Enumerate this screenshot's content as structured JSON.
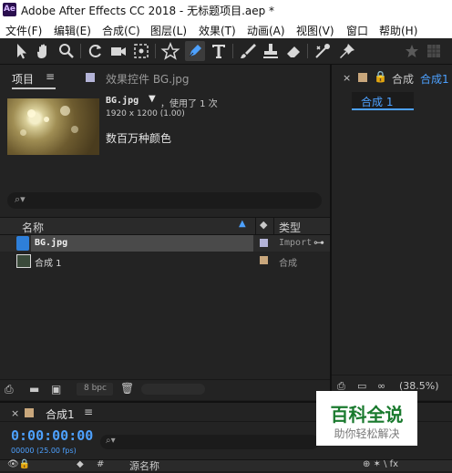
{
  "window": {
    "app_icon": "Ae",
    "title": "Adobe After Effects CC 2018 - 无标题项目.aep *"
  },
  "menu": [
    {
      "label": "文件(F)"
    },
    {
      "label": "编辑(E)"
    },
    {
      "label": "合成(C)"
    },
    {
      "label": "图层(L)"
    },
    {
      "label": "效果(T)"
    },
    {
      "label": "动画(A)"
    },
    {
      "label": "视图(V)"
    },
    {
      "label": "窗口"
    },
    {
      "label": "帮助(H)"
    }
  ],
  "toolbar": {
    "tools": [
      "selection-tool-icon",
      "hand-tool-icon",
      "zoom-tool-icon",
      "rotate-tool-icon",
      "camera-tool-icon",
      "pan-behind-tool-icon",
      "shape-tool-icon",
      "pen-tool-icon",
      "type-tool-icon",
      "brush-tool-icon",
      "clone-stamp-tool-icon",
      "eraser-tool-icon",
      "roto-brush-tool-icon",
      "puppet-pin-tool-icon"
    ]
  },
  "project_panel": {
    "tab_project": "项目",
    "tab_effects": "效果控件 BG.jpg",
    "selected_file": "BG.jpg",
    "usage_text": "，使用了 1 次",
    "dimensions": "1920 x 1200 (1.00)",
    "color_depth": "数百万种颜色",
    "search_placeholder": "",
    "columns": {
      "name": "名称",
      "type": "类型"
    },
    "rows": [
      {
        "name": "BG.jpg",
        "type": "Import",
        "label_color": "#b4b4d8"
      },
      {
        "name": "合成 1",
        "type": "合成",
        "label_color": "#c9a77c"
      }
    ],
    "bpc": "8 bpc"
  },
  "composition_panel": {
    "tab_label": "合成",
    "tab_name": "合成1",
    "comp_tab": "合成 1",
    "zoom": "(38.5%)"
  },
  "timeline": {
    "comp_name": "合成1",
    "timecode": "0:00:00:00",
    "frame_info": "00000 (25.00 fps)",
    "layer_column": "源名称"
  },
  "watermark": {
    "title": "百科全说",
    "subtitle": "助你轻松解决"
  }
}
